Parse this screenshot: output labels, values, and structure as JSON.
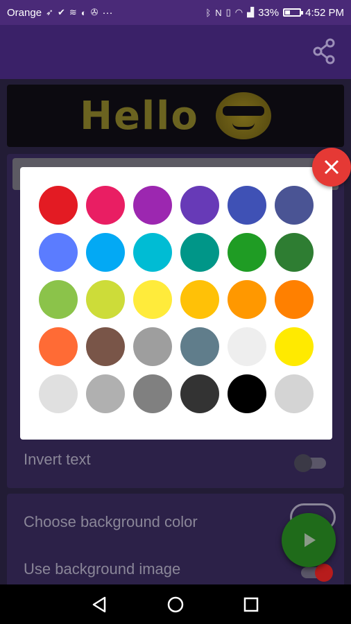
{
  "status_bar": {
    "carrier": "Orange",
    "notification_icons": [
      "navigation-icon",
      "check-icon",
      "cast-icon",
      "vpn-icon",
      "settings-icon"
    ],
    "more_notifications": "···",
    "battery_percent": "33%",
    "battery_level": 0.33,
    "time": "4:52 PM"
  },
  "app_bar": {
    "share_icon": "share-icon"
  },
  "background": {
    "led_preview_text": "Hello",
    "invert_text_label": "Invert text",
    "choose_bg_color_label": "Choose background color",
    "use_bg_image_label": "Use background image"
  },
  "color_picker": {
    "colors": [
      "#e31b23",
      "#e91e63",
      "#9c27b0",
      "#673ab7",
      "#3f51b5",
      "#4a5494",
      "#5b7cff",
      "#03a9f4",
      "#00bcd4",
      "#009688",
      "#1f9c24",
      "#2e7d32",
      "#8bc34a",
      "#cddc39",
      "#ffeb3b",
      "#ffc107",
      "#ff9800",
      "#ff8000",
      "#ff6b35",
      "#795548",
      "#9e9e9e",
      "#607d8b",
      "#eeeeee",
      "#ffea00",
      "#e0e0e0",
      "#b0b0b0",
      "#808080",
      "#333333",
      "#000000",
      "#d4d4d4"
    ],
    "close_icon": "close-icon"
  },
  "fab": {
    "icon": "play-icon",
    "color": "#1f6b1a"
  },
  "nav_bar": {
    "back_icon": "back-icon",
    "home_icon": "home-icon",
    "recents_icon": "recents-icon"
  }
}
